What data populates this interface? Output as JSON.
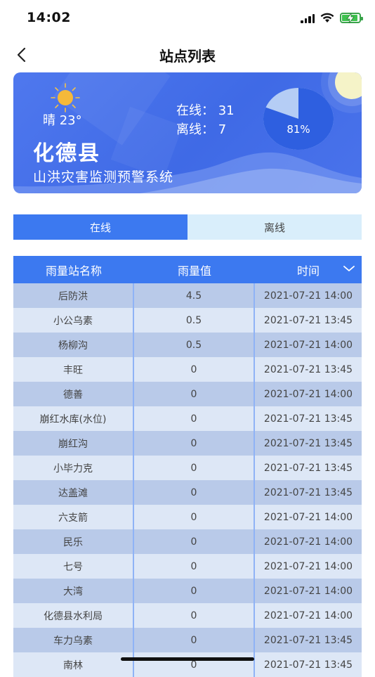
{
  "status_bar": {
    "time": "14:02"
  },
  "nav": {
    "title": "站点列表"
  },
  "banner": {
    "weather_text": "晴 23°",
    "county": "化德县",
    "system_name": "山洪灾害监测预警系统",
    "online_label": "在线：",
    "online_count": "31",
    "offline_label": "离线：",
    "offline_count": "7",
    "online_percent_label": "81%",
    "online_fraction": 0.81,
    "colors": {
      "pie_online": "#2e5fe0",
      "pie_offline": "#b5cdf5"
    }
  },
  "tabs": [
    {
      "label": "在线",
      "active": true
    },
    {
      "label": "离线",
      "active": false
    }
  ],
  "table": {
    "headers": [
      "雨量站名称",
      "雨量值",
      "时间"
    ],
    "rows": [
      [
        "后防洪",
        "4.5",
        "2021-07-21 14:00"
      ],
      [
        "小公乌素",
        "0.5",
        "2021-07-21 13:45"
      ],
      [
        "杨柳沟",
        "0.5",
        "2021-07-21 14:00"
      ],
      [
        "丰旺",
        "0",
        "2021-07-21 13:45"
      ],
      [
        "德善",
        "0",
        "2021-07-21 14:00"
      ],
      [
        "崩红水库(水位)",
        "0",
        "2021-07-21 13:45"
      ],
      [
        "崩红沟",
        "0",
        "2021-07-21 13:45"
      ],
      [
        "小毕力克",
        "0",
        "2021-07-21 13:45"
      ],
      [
        "达盖滩",
        "0",
        "2021-07-21 13:45"
      ],
      [
        "六支箭",
        "0",
        "2021-07-21 14:00"
      ],
      [
        "民乐",
        "0",
        "2021-07-21 14:00"
      ],
      [
        "七号",
        "0",
        "2021-07-21 14:00"
      ],
      [
        "大湾",
        "0",
        "2021-07-21 14:00"
      ],
      [
        "化德县水利局",
        "0",
        "2021-07-21 14:00"
      ],
      [
        "车力乌素",
        "0",
        "2021-07-21 13:45"
      ],
      [
        "南林",
        "0",
        "2021-07-21 13:45"
      ]
    ]
  }
}
